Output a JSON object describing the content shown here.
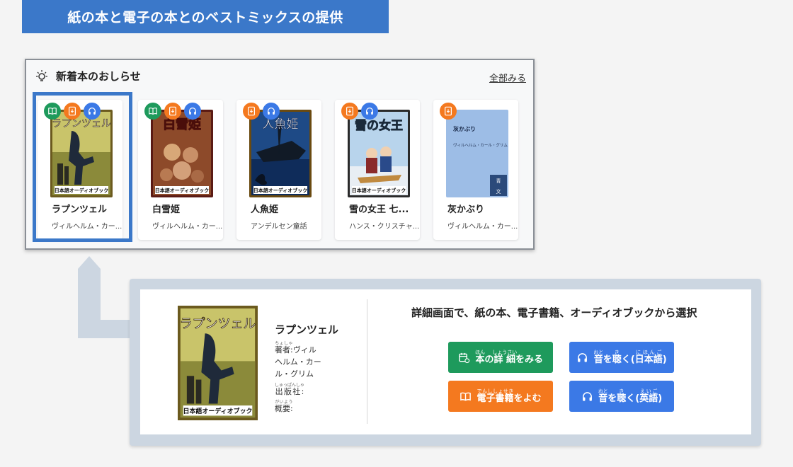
{
  "banner": {
    "title": "紙の本と電子の本とのベストミックスの提供"
  },
  "news": {
    "title": "新着本のおしらせ",
    "see_all": "全部みる",
    "cards": [
      {
        "title": "ラプンツェル",
        "author": "ヴィルヘルム・カー...",
        "cover_title": "ラプンツェル",
        "cover_label": "日本語オーディオブック",
        "badges": [
          "book-icon",
          "ebook-icon",
          "headphones-icon"
        ]
      },
      {
        "title": "白雪姫",
        "author": "ヴィルヘルム・カー...",
        "cover_title": "白雪姫",
        "cover_label": "日本語オーディオブック",
        "badges": [
          "book-icon",
          "ebook-icon",
          "headphones-icon"
        ]
      },
      {
        "title": "人魚姫",
        "author": "アンデルセン童話",
        "cover_title": "人魚姫",
        "cover_label": "日本語オーディオブック",
        "badges": [
          "ebook-icon",
          "headphones-icon"
        ]
      },
      {
        "title": "雪の女王 七...",
        "author": "ハンス・クリスチャ...",
        "cover_title": "雪の女王",
        "cover_label": "日本語オーディオブック",
        "badges": [
          "ebook-icon",
          "headphones-icon"
        ]
      },
      {
        "title": "灰かぶり",
        "author": "ヴィルヘルム・カー...",
        "cover_title": "灰かぶり",
        "cover_subtitle": "ヴィルヘルム・カール・グリム",
        "cover_publisher": "青空文庫",
        "badges": [
          "ebook-icon"
        ]
      }
    ]
  },
  "detail": {
    "title": "ラプンツェル",
    "cover_title": "ラプンツェル",
    "cover_label": "日本語オーディオブック",
    "author_label": "著者:",
    "author_label_ruby": "ちょしゃ",
    "author_lines": [
      "ヴィル",
      "ヘルム・カー",
      "ル・グリム"
    ],
    "publisher_label": "出版社:",
    "publisher_label_ruby": "しゅっぱんしゃ",
    "summary_label": "概要:",
    "summary_label_ruby": "がいよう",
    "heading": "詳細画面で、紙の本、電子書籍、オーディオブックから選択",
    "buttons": {
      "details": {
        "label": "本の詳細をみる",
        "ruby_hon": "ほん",
        "ruby_shousai": "しょうさい"
      },
      "listen_ja": {
        "label": "音を聴く(日本語)",
        "ruby_oto": "おと",
        "ruby_ki": "き",
        "ruby_nihongo": "にほんご"
      },
      "read_ebook": {
        "label": "電子書籍をよむ",
        "ruby": "でんししょせき"
      },
      "listen_en": {
        "label": "音を聴く(英語)",
        "ruby_oto": "おと",
        "ruby_ki": "き",
        "ruby_eigo": "えいご"
      }
    }
  },
  "colors": {
    "accent": "#3b78c9",
    "green": "#1e9a5c",
    "orange": "#f4791f",
    "blue": "#3b79e6"
  }
}
